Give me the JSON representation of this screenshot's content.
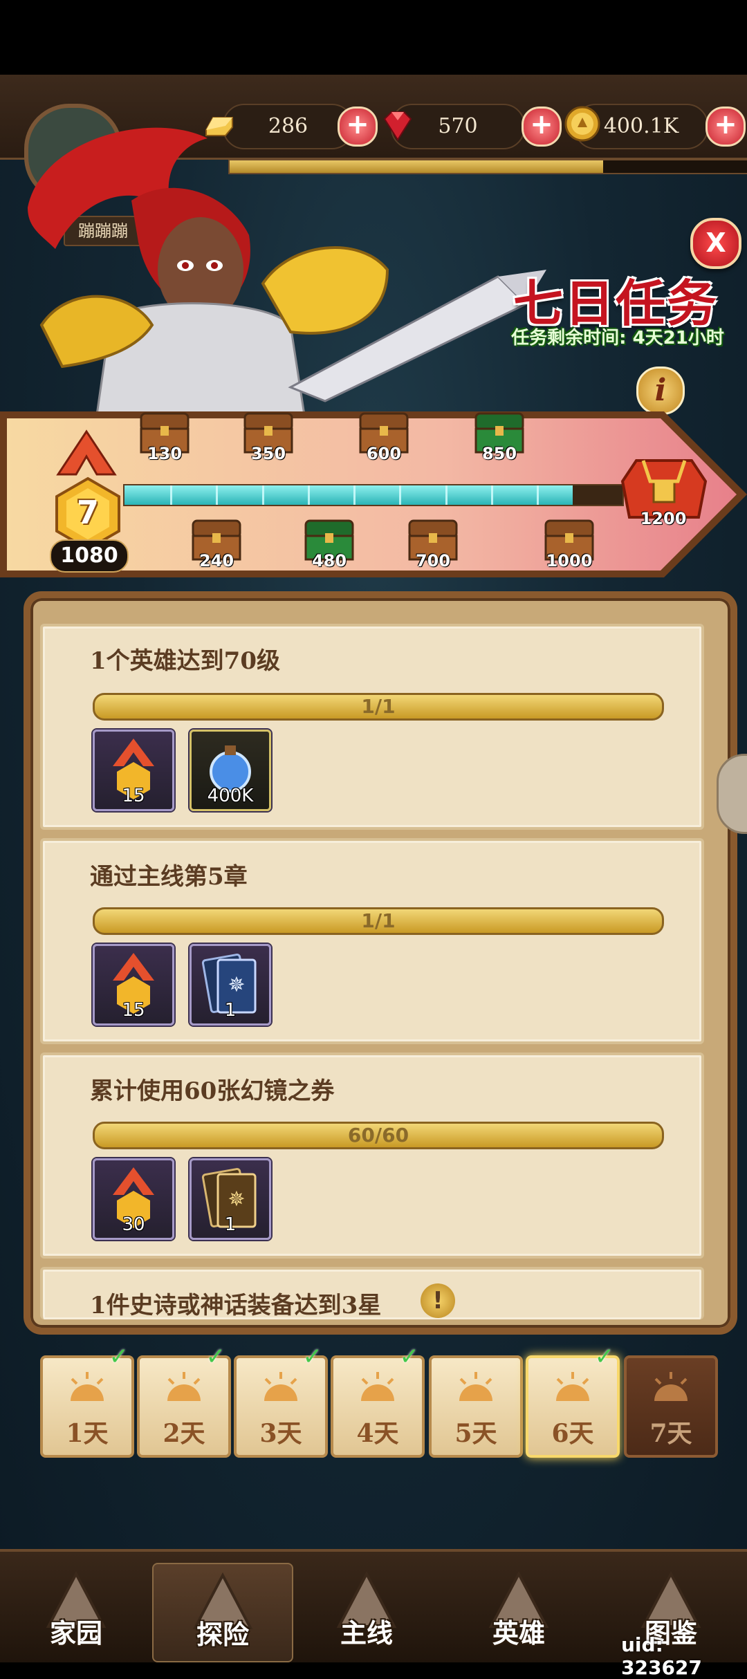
{
  "resources": {
    "gold_bars": "286",
    "gems": "570",
    "coins": "400.1K",
    "exp_progress": 0.72
  },
  "player": {
    "name": "蹦蹦蹦"
  },
  "event": {
    "title": "七日任务",
    "timer": "任务剩余时间: 4天21小时"
  },
  "milestones": {
    "score": "1080",
    "level": "7",
    "progress": 0.9,
    "top_chests": [
      "130",
      "350",
      "600",
      "850"
    ],
    "bottom_chests": [
      "240",
      "480",
      "700",
      "1000"
    ],
    "final_chest": "1200"
  },
  "tasks": [
    {
      "title": "1个英雄达到70级",
      "progress_text": "1/1",
      "rewards": [
        {
          "icon": "medal-icon",
          "count": "15"
        },
        {
          "icon": "potion-icon",
          "count": "400K"
        }
      ]
    },
    {
      "title": "通过主线第5章",
      "progress_text": "1/1",
      "rewards": [
        {
          "icon": "medal-icon",
          "count": "15"
        },
        {
          "icon": "blue-card-icon",
          "count": "1"
        }
      ]
    },
    {
      "title": "累计使用60张幻镜之券",
      "progress_text": "60/60",
      "rewards": [
        {
          "icon": "medal-icon",
          "count": "30"
        },
        {
          "icon": "gold-card-icon",
          "count": "1"
        }
      ]
    },
    {
      "title": "1件史诗或神话装备达到3星"
    }
  ],
  "days": [
    {
      "label": "1天",
      "done": true
    },
    {
      "label": "2天",
      "done": true
    },
    {
      "label": "3天",
      "done": true
    },
    {
      "label": "4天",
      "done": true
    },
    {
      "label": "5天",
      "done": false
    },
    {
      "label": "6天",
      "done": true,
      "selected": true
    },
    {
      "label": "7天",
      "done": false,
      "locked": true
    }
  ],
  "nav": [
    "家园",
    "探险",
    "主线",
    "英雄",
    "图鉴"
  ],
  "uid": "uid: 323627",
  "colors": {
    "title_red": "#c51420",
    "progress_teal": "#2ab4b6",
    "panel_tan": "#c8a978",
    "check_green": "#43c94a"
  }
}
